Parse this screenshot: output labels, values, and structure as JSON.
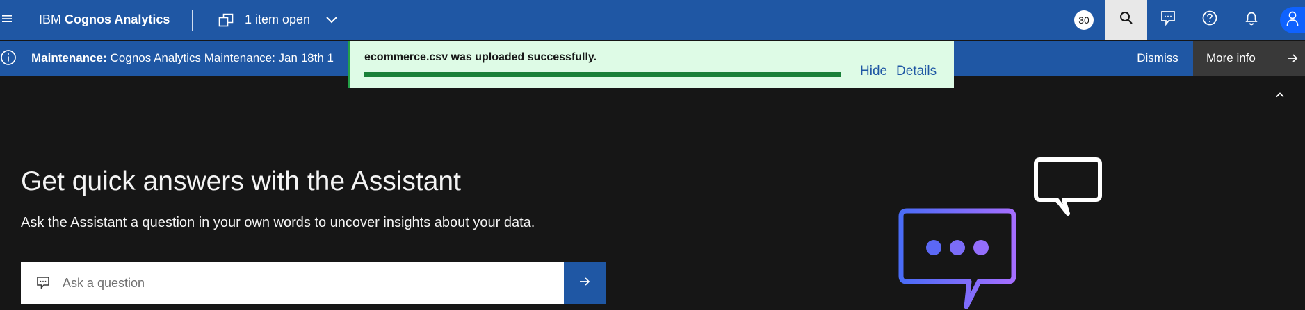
{
  "header": {
    "brand_prefix": "IBM",
    "brand_name": "Cognos Analytics",
    "items_open_label": "1 item open",
    "badge_count": "30",
    "icons": [
      "menu-icon",
      "open-items-icon",
      "chevron-down-icon",
      "search-icon",
      "chat-icon",
      "help-icon",
      "notification-icon",
      "user-icon"
    ]
  },
  "banner": {
    "title": "Maintenance:",
    "message": "Cognos Analytics Maintenance: Jan 18th 1",
    "dismiss_label": "Dismiss",
    "more_info_label": "More info"
  },
  "toast": {
    "message": "ecommerce.csv was uploaded successfully.",
    "progress": 1.0,
    "hide_label": "Hide",
    "details_label": "Details"
  },
  "hero": {
    "title": "Get quick answers with the Assistant",
    "subtitle": "Ask the Assistant a question in your own words to uncover insights about your data.",
    "ask_placeholder": "Ask a question"
  },
  "colors": {
    "header_bg": "#1f57a4",
    "page_bg": "#161616",
    "toast_bg": "#defbe6",
    "toast_progress": "#198038",
    "more_info_bg": "#393939",
    "avatar_bg": "#0f62fe"
  }
}
